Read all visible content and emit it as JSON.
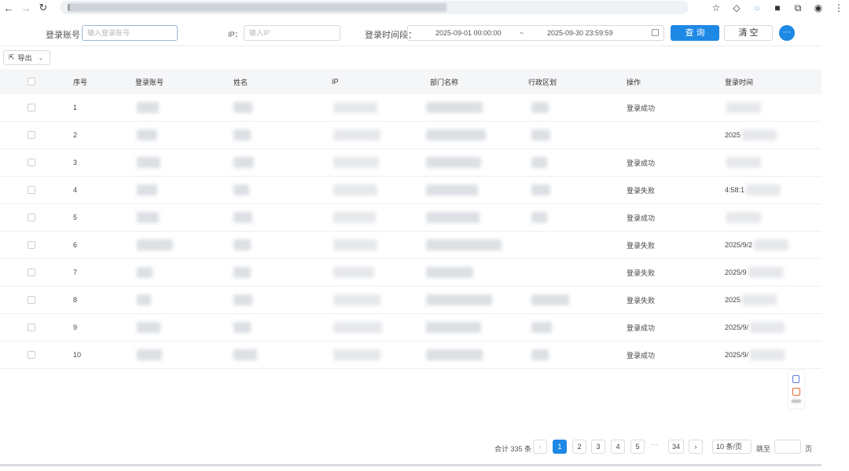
{
  "filters": {
    "account_label": "登录账号：",
    "account_placeholder": "输入登录账号",
    "ip_label": "IP：",
    "ip_placeholder": "输入IP",
    "time_label": "登录时间段：",
    "time_start": "2025-09-01 00:00:00",
    "time_sep": "~",
    "time_end": "2025-09-30 23:59:59",
    "query_label": "查 询",
    "clear_label": "清 空",
    "more_label": "···"
  },
  "toolbar": {
    "export_label": "导出"
  },
  "table": {
    "headers": [
      "序号",
      "登录账号",
      "姓名",
      "IP",
      "部门名称",
      "行政区划",
      "操作",
      "登录时间"
    ],
    "rows": [
      {
        "index": "1",
        "action": "登录成功",
        "time": ""
      },
      {
        "index": "2",
        "action": "",
        "time": "2025"
      },
      {
        "index": "3",
        "action": "登录成功",
        "time": ""
      },
      {
        "index": "4",
        "action": "登录失败",
        "time": "4:58:1"
      },
      {
        "index": "5",
        "action": "登录成功",
        "time": ""
      },
      {
        "index": "6",
        "action": "登录失败",
        "time": "2025/9/2"
      },
      {
        "index": "7",
        "action": "登录失败",
        "time": "2025/9"
      },
      {
        "index": "8",
        "action": "登录失败",
        "time": "2025"
      },
      {
        "index": "9",
        "action": "登录成功",
        "time": "2025/9/"
      },
      {
        "index": "10",
        "action": "登录成功",
        "time": "2025/9/"
      }
    ]
  },
  "pagination": {
    "total": "合计 335 条",
    "prev": "‹",
    "pages": [
      "1",
      "2",
      "3",
      "4",
      "5"
    ],
    "ellipsis": "···",
    "last_page": "34",
    "next": "›",
    "page_size": "10 条/页",
    "jump_label": "跳至",
    "jump_unit": "页"
  },
  "colors": {
    "primary": "#1e88e5",
    "header_bg": "#f5f6f8"
  }
}
